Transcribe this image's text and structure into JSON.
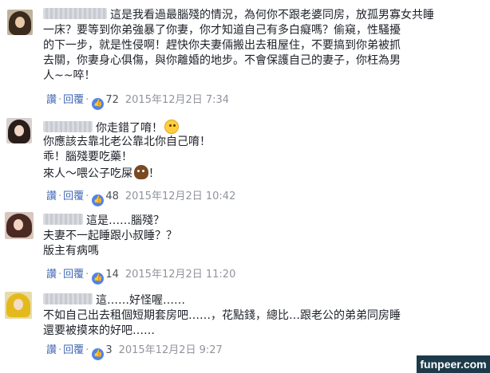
{
  "comments": [
    {
      "lines": [
        "這是我看過最腦殘的情況，為何你不跟老婆同房，放孤男寡女共睡",
        "一床？要等到你弟強暴了你妻，你才知道自己有多白癡嗎？偷窺，性騷擾",
        "的下一步，就是性侵啊！趕快你夫妻倆搬出去租屋住，不要搞到你弟被抓",
        "去關，你妻身心俱傷，與你離婚的地步。不會保護自己的妻子，你枉為男",
        "人~~啐！"
      ],
      "actions": {
        "reply_action": "讚",
        "reply": "回覆"
      },
      "likes": "72",
      "timestamp": "2015年12月2日 7:34"
    },
    {
      "lines": [
        "你走錯了唷！",
        "你應該去靠北老公靠北你自己唷！",
        "乖！腦殘要吃藥！",
        "來人～喂公子吃屎",
        "！"
      ],
      "actions": {
        "reply_action": "讚",
        "reply": "回覆"
      },
      "likes": "48",
      "timestamp": "2015年12月2日 10:42"
    },
    {
      "lines": [
        "這是……腦殘？",
        "夫妻不一起睡跟小叔睡？？",
        "版主有病嗎"
      ],
      "actions": {
        "reply_action": "讚",
        "reply": "回覆"
      },
      "likes": "14",
      "timestamp": "2015年12月2日 11:20"
    },
    {
      "lines": [
        "這……好怪喔……",
        "不如自己出去租個短期套房吧……，花點錢，總比…跟老公的弟弟同房睡",
        "還要被摸來的好吧……"
      ],
      "actions": {
        "reply_action": "讚",
        "reply": "回覆"
      },
      "likes": "3",
      "timestamp": "2015年12月2日 9:27"
    }
  ],
  "icons": {
    "like": "thumbs-up-icon",
    "think": "thinking-face-emoji",
    "poo": "pile-of-poo-emoji"
  },
  "colors": {
    "link": "#4267b2",
    "like_badge": "#4e82ee",
    "meta": "#90949c"
  },
  "watermark": "funpeer.com"
}
